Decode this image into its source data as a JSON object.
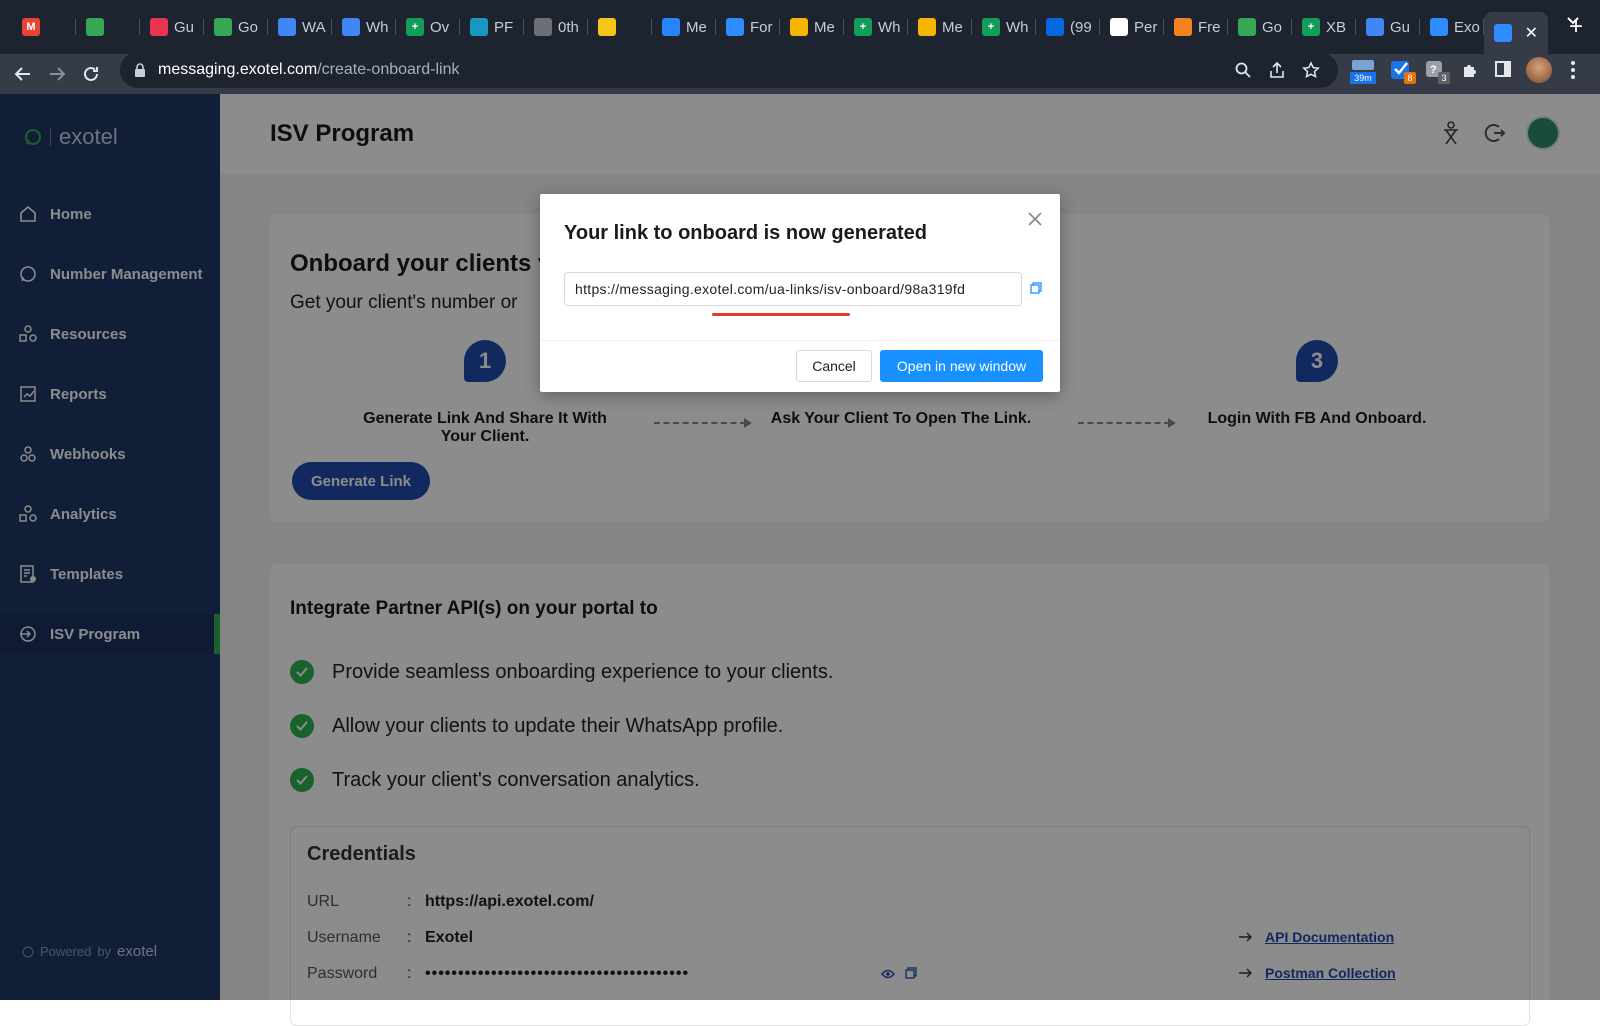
{
  "browser": {
    "tabs": [
      {
        "label": "",
        "color": "#ea4335",
        "glyph": "M"
      },
      {
        "label": "",
        "color": "#34a853",
        "glyph": ""
      },
      {
        "label": "Gu",
        "color": "#e8344e",
        "glyph": ""
      },
      {
        "label": "Go",
        "color": "#34a853",
        "glyph": ""
      },
      {
        "label": "WA",
        "color": "#4285f4",
        "glyph": ""
      },
      {
        "label": "Wh",
        "color": "#4285f4",
        "glyph": ""
      },
      {
        "label": "Ov",
        "color": "#0f9d58",
        "glyph": "+"
      },
      {
        "label": "PF",
        "color": "#1798c1",
        "glyph": ""
      },
      {
        "label": "0th",
        "color": "#6b6f76",
        "glyph": ""
      },
      {
        "label": "",
        "color": "#f5c518",
        "glyph": ""
      },
      {
        "label": "Me",
        "color": "#2684ff",
        "glyph": ""
      },
      {
        "label": "For",
        "color": "#2d8cff",
        "glyph": ""
      },
      {
        "label": "Me",
        "color": "#f4b400",
        "glyph": ""
      },
      {
        "label": "Wh",
        "color": "#0f9d58",
        "glyph": "+"
      },
      {
        "label": "Me",
        "color": "#f4b400",
        "glyph": ""
      },
      {
        "label": "Wh",
        "color": "#0f9d58",
        "glyph": "+"
      },
      {
        "label": "(99",
        "color": "#0668e1",
        "glyph": ""
      },
      {
        "label": "Per",
        "color": "#ffffff",
        "glyph": ""
      },
      {
        "label": "Fre",
        "color": "#f58220",
        "glyph": ""
      },
      {
        "label": "Go",
        "color": "#34a853",
        "glyph": ""
      },
      {
        "label": "XB",
        "color": "#0f9d58",
        "glyph": "+"
      },
      {
        "label": "Gu",
        "color": "#4285f4",
        "glyph": ""
      },
      {
        "label": "Exo",
        "color": "#2d8cff",
        "glyph": ""
      }
    ],
    "url_host": "messaging.exotel.com",
    "url_path": "/create-onboard-link",
    "ext_timer": "39m",
    "ext_badge_1": "8",
    "ext_badge_2": "3"
  },
  "sidebar": {
    "logo_text": "exotel",
    "items": [
      {
        "label": "Home",
        "icon": "home-icon"
      },
      {
        "label": "Number Management",
        "icon": "whatsapp-icon"
      },
      {
        "label": "Resources",
        "icon": "shapes-icon"
      },
      {
        "label": "Reports",
        "icon": "chart-icon"
      },
      {
        "label": "Webhooks",
        "icon": "webhook-icon"
      },
      {
        "label": "Analytics",
        "icon": "shapes-icon"
      },
      {
        "label": "Templates",
        "icon": "template-icon"
      },
      {
        "label": "ISV Program",
        "icon": "isv-icon"
      }
    ],
    "powered_by": "Powered",
    "powered_by_2": "by",
    "powered_logo": "exotel"
  },
  "header": {
    "title": "ISV Program"
  },
  "onboard": {
    "title": "Onboard your clients v",
    "subtitle": "Get your client's number or",
    "steps": [
      {
        "num": "1",
        "text": "Generate Link And Share It With Your Client."
      },
      {
        "num": "2",
        "text": "Ask Your Client To Open The Link."
      },
      {
        "num": "3",
        "text": "Login With FB And Onboard."
      }
    ],
    "generate_label": "Generate Link"
  },
  "integrate": {
    "title": "Integrate Partner API(s) on your portal to",
    "bullets": [
      "Provide seamless onboarding experience to your clients.",
      "Allow your clients to update their WhatsApp profile.",
      "Track your client's conversation analytics."
    ]
  },
  "credentials": {
    "title": "Credentials",
    "rows": [
      {
        "key": "URL",
        "value": "https://api.exotel.com/"
      },
      {
        "key": "Username",
        "value": "Exotel"
      },
      {
        "key": "Password",
        "value": "••••••••••••••••••••••••••••••••••••••••"
      }
    ],
    "api_doc": "API Documentation",
    "postman": "Postman Collection"
  },
  "modal": {
    "title": "Your link to onboard is now generated",
    "link": "https://messaging.exotel.com/ua-links/isv-onboard/98a319fd",
    "cancel": "Cancel",
    "open": "Open in new window"
  },
  "colors": {
    "sidebar": "#1f3867",
    "accent": "#1f4cab",
    "primary_button": "#1890ff",
    "check": "#2fb351"
  }
}
